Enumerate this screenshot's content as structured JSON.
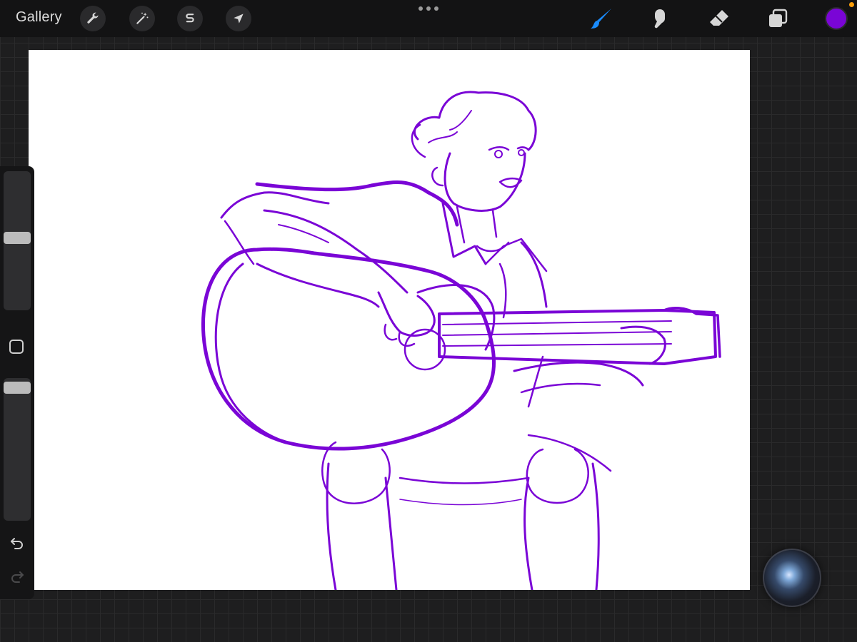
{
  "topbar": {
    "gallery_label": "Gallery",
    "left_tools": [
      {
        "icon": "wrench-icon",
        "name": "actions"
      },
      {
        "icon": "magic-wand-icon",
        "name": "adjustments"
      },
      {
        "icon": "selection-s-icon",
        "name": "selection"
      },
      {
        "icon": "arrow-cursor-icon",
        "name": "transform"
      }
    ],
    "right_tools": [
      {
        "icon": "brush-icon",
        "name": "brush",
        "active": true
      },
      {
        "icon": "smudge-icon",
        "name": "smudge"
      },
      {
        "icon": "eraser-icon",
        "name": "eraser"
      },
      {
        "icon": "layers-icon",
        "name": "layers"
      }
    ],
    "current_color": "#7a05d6",
    "active_tool_color": "#1a8cff"
  },
  "sidebar": {
    "brush_size_level": 0.55,
    "opacity_level": 0.05,
    "icons": [
      "undo-icon",
      "redo-icon"
    ]
  },
  "canvas": {
    "stroke_color": "#7a05d6",
    "background": "#ffffff"
  }
}
